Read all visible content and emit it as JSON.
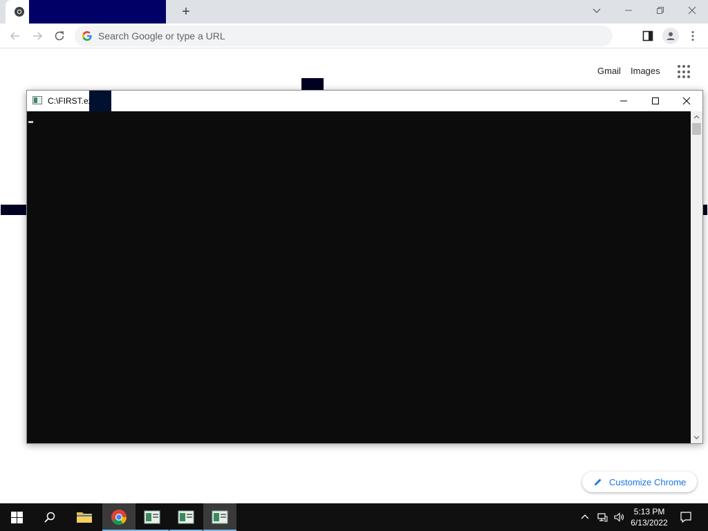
{
  "browser": {
    "new_tab_label": "+",
    "address_bar": {
      "placeholder": "Search Google or type a URL",
      "value": ""
    }
  },
  "google_page": {
    "gmail_link": "Gmail",
    "images_link": "Images",
    "customize_button": "Customize Chrome"
  },
  "console_window": {
    "title": "C:\\FIRST.exe"
  },
  "taskbar": {
    "clock_time": "5:13 PM",
    "clock_date": "6/13/2022"
  },
  "colors": {
    "chrome_tabstrip": "#dee1e6",
    "console_background": "#0c0c0c",
    "taskbar_background": "#101010",
    "link_blue": "#1a73e8"
  }
}
